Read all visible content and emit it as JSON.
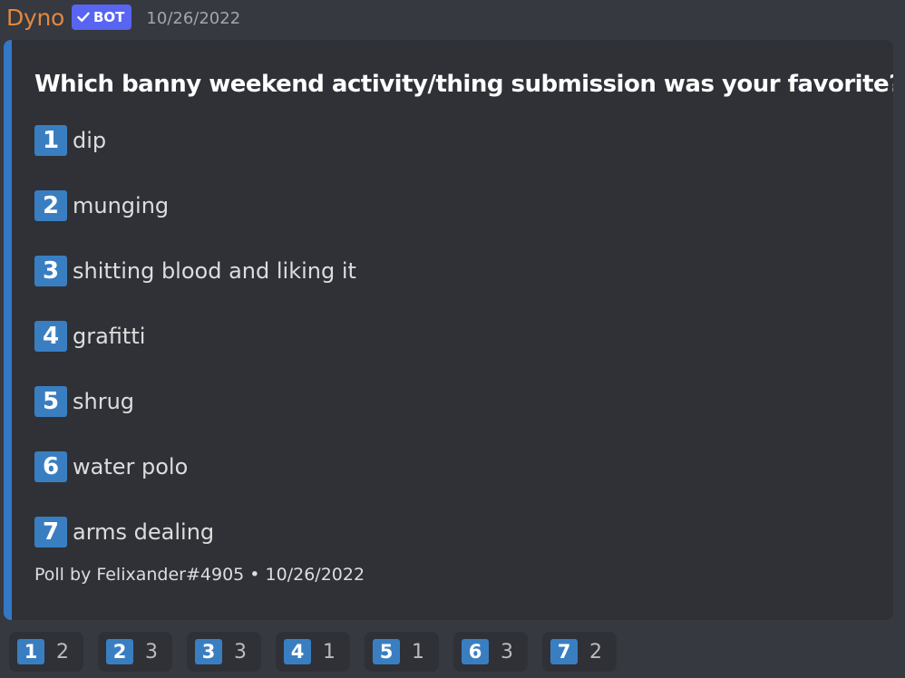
{
  "message": {
    "author": "Dyno",
    "badge": "BOT",
    "timestamp": "10/26/2022",
    "colors": {
      "author": "#e3873f",
      "badge": "#5865f2",
      "accent_bar": "#3378c5",
      "number_box": "#3a7ec2"
    }
  },
  "embed": {
    "title": "Which banny weekend activity/thing submission was your favorite?",
    "options": [
      {
        "number": "1",
        "text": "dip"
      },
      {
        "number": "2",
        "text": "munging"
      },
      {
        "number": "3",
        "text": "shitting blood and liking it"
      },
      {
        "number": "4",
        "text": "grafitti"
      },
      {
        "number": "5",
        "text": "shrug"
      },
      {
        "number": "6",
        "text": "water polo"
      },
      {
        "number": "7",
        "text": "arms dealing"
      }
    ],
    "footer": "Poll by Felixander#4905 • 10/26/2022"
  },
  "reactions": [
    {
      "emoji": "1",
      "count": "2"
    },
    {
      "emoji": "2",
      "count": "3"
    },
    {
      "emoji": "3",
      "count": "3"
    },
    {
      "emoji": "4",
      "count": "1"
    },
    {
      "emoji": "5",
      "count": "1"
    },
    {
      "emoji": "6",
      "count": "3"
    },
    {
      "emoji": "7",
      "count": "2"
    }
  ]
}
